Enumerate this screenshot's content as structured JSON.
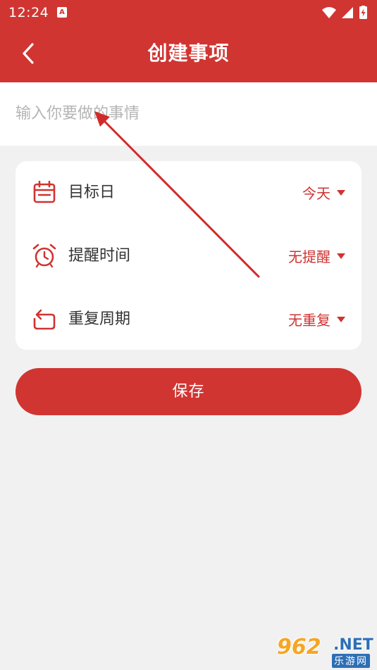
{
  "status_bar": {
    "time": "12:24",
    "app_badge": "A",
    "icons": [
      "wifi-icon",
      "signal-icon",
      "battery-charging-icon"
    ]
  },
  "header": {
    "back_icon": "chevron-left-icon",
    "title": "创建事项"
  },
  "task_input": {
    "placeholder": "输入你要做的事情",
    "value": ""
  },
  "settings": {
    "target_date": {
      "icon": "calendar-icon",
      "label": "目标日",
      "value": "今天"
    },
    "reminder": {
      "icon": "alarm-clock-icon",
      "label": "提醒时间",
      "value": "无提醒"
    },
    "repeat": {
      "icon": "repeat-icon",
      "label": "重复周期",
      "value": "无重复"
    }
  },
  "save_button": {
    "label": "保存"
  },
  "watermark": {
    "number": "962",
    "domain": ".NET",
    "subtitle": "乐游网"
  },
  "colors": {
    "primary": "#d03532",
    "background": "#f1f1f1",
    "card": "#ffffff",
    "value_text": "#cf3331",
    "label_text": "#333333",
    "placeholder": "#b5b5b5"
  }
}
